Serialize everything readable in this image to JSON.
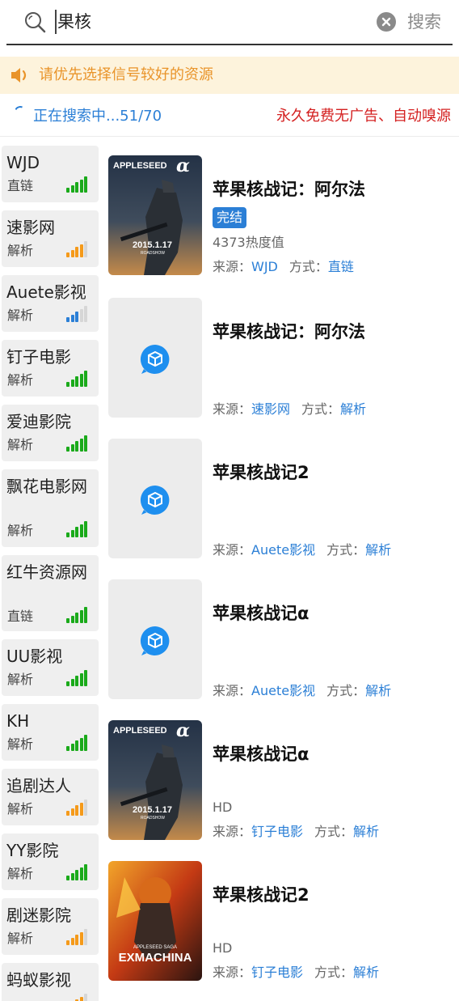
{
  "search": {
    "query": "果核",
    "button_label": "搜索"
  },
  "notice": {
    "text": "请优先选择信号较好的资源"
  },
  "status": {
    "progress": "正在搜索中...51/70",
    "promo": "永久免费无广告、自动嗅源"
  },
  "sources": [
    {
      "name": "WJD",
      "method": "直链",
      "signal": 5,
      "color": "#1aaa1a"
    },
    {
      "name": "速影网",
      "method": "解析",
      "signal": 4,
      "color": "#f59a1a"
    },
    {
      "name": "Auete影视",
      "method": "解析",
      "signal": 3,
      "color": "#2b7fd6"
    },
    {
      "name": "钉子电影",
      "method": "解析",
      "signal": 5,
      "color": "#1aaa1a"
    },
    {
      "name": "爱迪影院",
      "method": "解析",
      "signal": 5,
      "color": "#1aaa1a"
    },
    {
      "name": "飘花电影网",
      "method": "解析",
      "signal": 5,
      "color": "#1aaa1a"
    },
    {
      "name": "红牛资源网",
      "method": "直链",
      "signal": 5,
      "color": "#1aaa1a"
    },
    {
      "name": "UU影视",
      "method": "解析",
      "signal": 5,
      "color": "#1aaa1a"
    },
    {
      "name": "KH",
      "method": "解析",
      "signal": 5,
      "color": "#1aaa1a"
    },
    {
      "name": "追剧达人",
      "method": "解析",
      "signal": 4,
      "color": "#f59a1a"
    },
    {
      "name": "YY影院",
      "method": "解析",
      "signal": 5,
      "color": "#1aaa1a"
    },
    {
      "name": "剧迷影院",
      "method": "解析",
      "signal": 4,
      "color": "#f59a1a"
    },
    {
      "name": "蚂蚁影视",
      "method": "",
      "signal": 4,
      "color": "#f59a1a"
    }
  ],
  "results": [
    {
      "title": "苹果核战记：阿尔法",
      "badge": "完结",
      "extra": "4373热度值",
      "source_label": "来源：",
      "source": "WJD",
      "method_label": "方式：",
      "method": "直链",
      "poster": "appleseed-alpha"
    },
    {
      "title": "苹果核战记：阿尔法",
      "badge": "",
      "extra": "",
      "source_label": "来源：",
      "source": "速影网",
      "method_label": "方式：",
      "method": "解析",
      "poster": "placeholder"
    },
    {
      "title": "苹果核战记2",
      "badge": "",
      "extra": "",
      "source_label": "来源：",
      "source": "Auete影视",
      "method_label": "方式：",
      "method": "解析",
      "poster": "placeholder"
    },
    {
      "title": "苹果核战记α",
      "badge": "",
      "extra": "",
      "source_label": "来源：",
      "source": "Auete影视",
      "method_label": "方式：",
      "method": "解析",
      "poster": "placeholder"
    },
    {
      "title": "苹果核战记α",
      "badge": "",
      "extra": "HD",
      "source_label": "来源：",
      "source": "钉子电影",
      "method_label": "方式：",
      "method": "解析",
      "poster": "appleseed-alpha"
    },
    {
      "title": "苹果核战记2",
      "badge": "",
      "extra": "HD",
      "source_label": "来源：",
      "source": "钉子电影",
      "method_label": "方式：",
      "method": "解析",
      "poster": "appleseed-ex-machina"
    }
  ],
  "posters": {
    "appleseed-alpha": {
      "logo": "APPLESEED",
      "glyph": "α",
      "date": "2015.1.17",
      "sub": "ROADSHOW"
    },
    "appleseed-ex-machina": {
      "logo": "APPLESEED SAGA",
      "glyph": "EXMACHINA",
      "date": "",
      "sub": ""
    }
  },
  "colors": {
    "accent": "#2b7fd6",
    "notice_bg": "#fdf3dc",
    "notice_text": "#e9942a",
    "promo": "#d42020"
  }
}
